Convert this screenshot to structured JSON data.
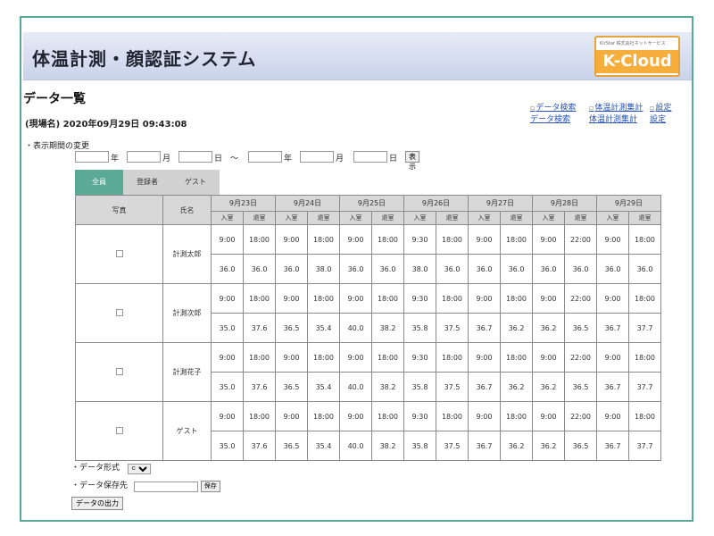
{
  "header": {
    "title": "体温計測・顔認証システム",
    "logo_small": "KirStar 株式会社ネットサービス",
    "logo_main": "K-Cloud"
  },
  "page": {
    "title": "データ一覧",
    "place_line": "(現場名) 2020年09月29日 09:43:08"
  },
  "links": [
    {
      "broken": "データ検索",
      "text": "データ検索"
    },
    {
      "broken": "体温計測集計",
      "text": "体温計測集計"
    },
    {
      "broken": "設定",
      "text": "設定"
    }
  ],
  "period": {
    "label": "・表示期間の変更",
    "year": "年",
    "month": "月",
    "day": "日",
    "tilde": "～",
    "show_button": "表示"
  },
  "tabs": [
    "全員",
    "登録者",
    "ゲスト"
  ],
  "table": {
    "photo_header": "写真",
    "name_header": "氏名",
    "dates": [
      "9月23日",
      "9月24日",
      "9月25日",
      "9月26日",
      "9月27日",
      "9月28日",
      "9月29日"
    ],
    "in_label": "入室",
    "out_label": "退室",
    "rows": [
      {
        "name": "計測太郎",
        "times": [
          "9:00",
          "18:00",
          "9:00",
          "18:00",
          "9:00",
          "18:00",
          "9:30",
          "18:00",
          "9:00",
          "18:00",
          "9:00",
          "22:00",
          "9:00",
          "18:00"
        ],
        "temps": [
          "36.0",
          "36.0",
          "36.0",
          "38.0",
          "36.0",
          "36.0",
          "38.0",
          "36.0",
          "36.0",
          "36.0",
          "36.0",
          "36.0",
          "36.0",
          "36.0"
        ]
      },
      {
        "name": "計測次郎",
        "times": [
          "9:00",
          "18:00",
          "9:00",
          "18:00",
          "9:00",
          "18:00",
          "9:30",
          "18:00",
          "9:00",
          "18:00",
          "9:00",
          "22:00",
          "9:00",
          "18:00"
        ],
        "temps": [
          "35.0",
          "37.6",
          "36.5",
          "35.4",
          "40.0",
          "38.2",
          "35.8",
          "37.5",
          "36.7",
          "36.2",
          "36.2",
          "36.5",
          "36.7",
          "37.7"
        ]
      },
      {
        "name": "計測花子",
        "times": [
          "9:00",
          "18:00",
          "9:00",
          "18:00",
          "9:00",
          "18:00",
          "9:30",
          "18:00",
          "9:00",
          "18:00",
          "9:00",
          "22:00",
          "9:00",
          "18:00"
        ],
        "temps": [
          "35.0",
          "37.6",
          "36.5",
          "35.4",
          "40.0",
          "38.2",
          "35.8",
          "37.5",
          "36.7",
          "36.2",
          "36.2",
          "36.5",
          "36.7",
          "37.7"
        ]
      },
      {
        "name": "ゲスト",
        "times": [
          "9:00",
          "18:00",
          "9:00",
          "18:00",
          "9:00",
          "18:00",
          "9:30",
          "18:00",
          "9:00",
          "18:00",
          "9:00",
          "22:00",
          "9:00",
          "18:00"
        ],
        "temps": [
          "35.0",
          "37.6",
          "36.5",
          "35.4",
          "40.0",
          "38.2",
          "35.8",
          "37.5",
          "36.7",
          "36.2",
          "36.2",
          "36.5",
          "36.7",
          "37.7"
        ]
      }
    ]
  },
  "bottom": {
    "format_label": "・データ形式",
    "format_value": "csv",
    "save_label": "・データ保存先",
    "save_button": "保存",
    "output_button": "データの出力"
  },
  "colors": {
    "accent": "#5aaa96",
    "logo": "#f5ad3c",
    "link": "#2753b0"
  }
}
